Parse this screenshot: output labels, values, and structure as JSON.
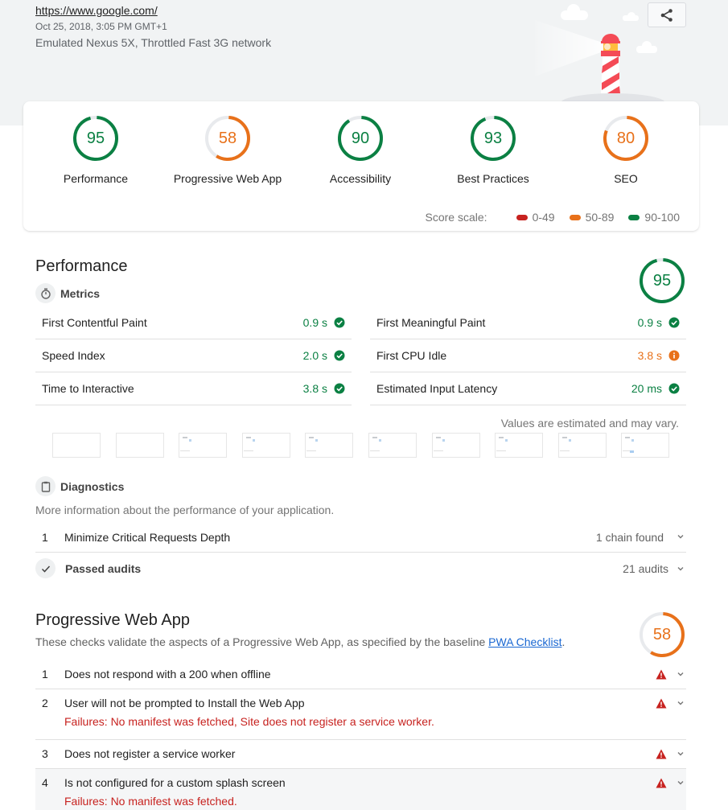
{
  "header": {
    "url": "https://www.google.com/",
    "date": "Oct 25, 2018, 3:05 PM GMT+1",
    "environment": "Emulated Nexus 5X, Throttled Fast 3G network",
    "share_icon": "share-icon"
  },
  "colors": {
    "pass": "#0b8043",
    "average": "#e8711a",
    "fail": "#c7221f",
    "gauge_track": "#e8eaed",
    "link": "#1967d2"
  },
  "categories": [
    {
      "label": "Performance",
      "score": 95
    },
    {
      "label": "Progressive Web App",
      "score": 58
    },
    {
      "label": "Accessibility",
      "score": 90
    },
    {
      "label": "Best Practices",
      "score": 93
    },
    {
      "label": "SEO",
      "score": 80
    }
  ],
  "score_scale": {
    "label": "Score scale:",
    "ranges": [
      {
        "label": "0-49",
        "rating": "fail"
      },
      {
        "label": "50-89",
        "rating": "average"
      },
      {
        "label": "90-100",
        "rating": "pass"
      }
    ]
  },
  "performance": {
    "title": "Performance",
    "score": 95,
    "metrics_title": "Metrics",
    "metrics_icon": "stopwatch-icon",
    "metrics": [
      {
        "name": "First Contentful Paint",
        "value": "0.9 s",
        "rating": "pass"
      },
      {
        "name": "Speed Index",
        "value": "2.0 s",
        "rating": "pass"
      },
      {
        "name": "Time to Interactive",
        "value": "3.8 s",
        "rating": "pass"
      },
      {
        "name": "First Meaningful Paint",
        "value": "0.9 s",
        "rating": "pass"
      },
      {
        "name": "First CPU Idle",
        "value": "3.8 s",
        "rating": "average"
      },
      {
        "name": "Estimated Input Latency",
        "value": "20 ms",
        "rating": "pass"
      }
    ],
    "estimate_note": "Values are estimated and may vary.",
    "filmstrip_frames": 10,
    "diagnostics": {
      "title": "Diagnostics",
      "icon": "clipboard-icon",
      "description": "More information about the performance of your application.",
      "audits": [
        {
          "num": "1",
          "title": "Minimize Critical Requests Depth",
          "display": "1 chain found"
        }
      ]
    },
    "passed": {
      "title": "Passed audits",
      "icon": "checkmark-icon",
      "count": "21 audits"
    }
  },
  "pwa": {
    "title": "Progressive Web App",
    "score": 58,
    "description_prefix": "These checks validate the aspects of a Progressive Web App, as specified by the baseline ",
    "link_text": "PWA Checklist",
    "description_suffix": ".",
    "audits": [
      {
        "num": "1",
        "title": "Does not respond with a 200 when offline",
        "failures": ""
      },
      {
        "num": "2",
        "title": "User will not be prompted to Install the Web App",
        "failures": "Failures: No manifest was fetched, Site does not register a service worker."
      },
      {
        "num": "3",
        "title": "Does not register a service worker",
        "failures": ""
      },
      {
        "num": "4",
        "title": "Is not configured for a custom splash screen",
        "failures": "Failures: No manifest was fetched."
      }
    ]
  }
}
